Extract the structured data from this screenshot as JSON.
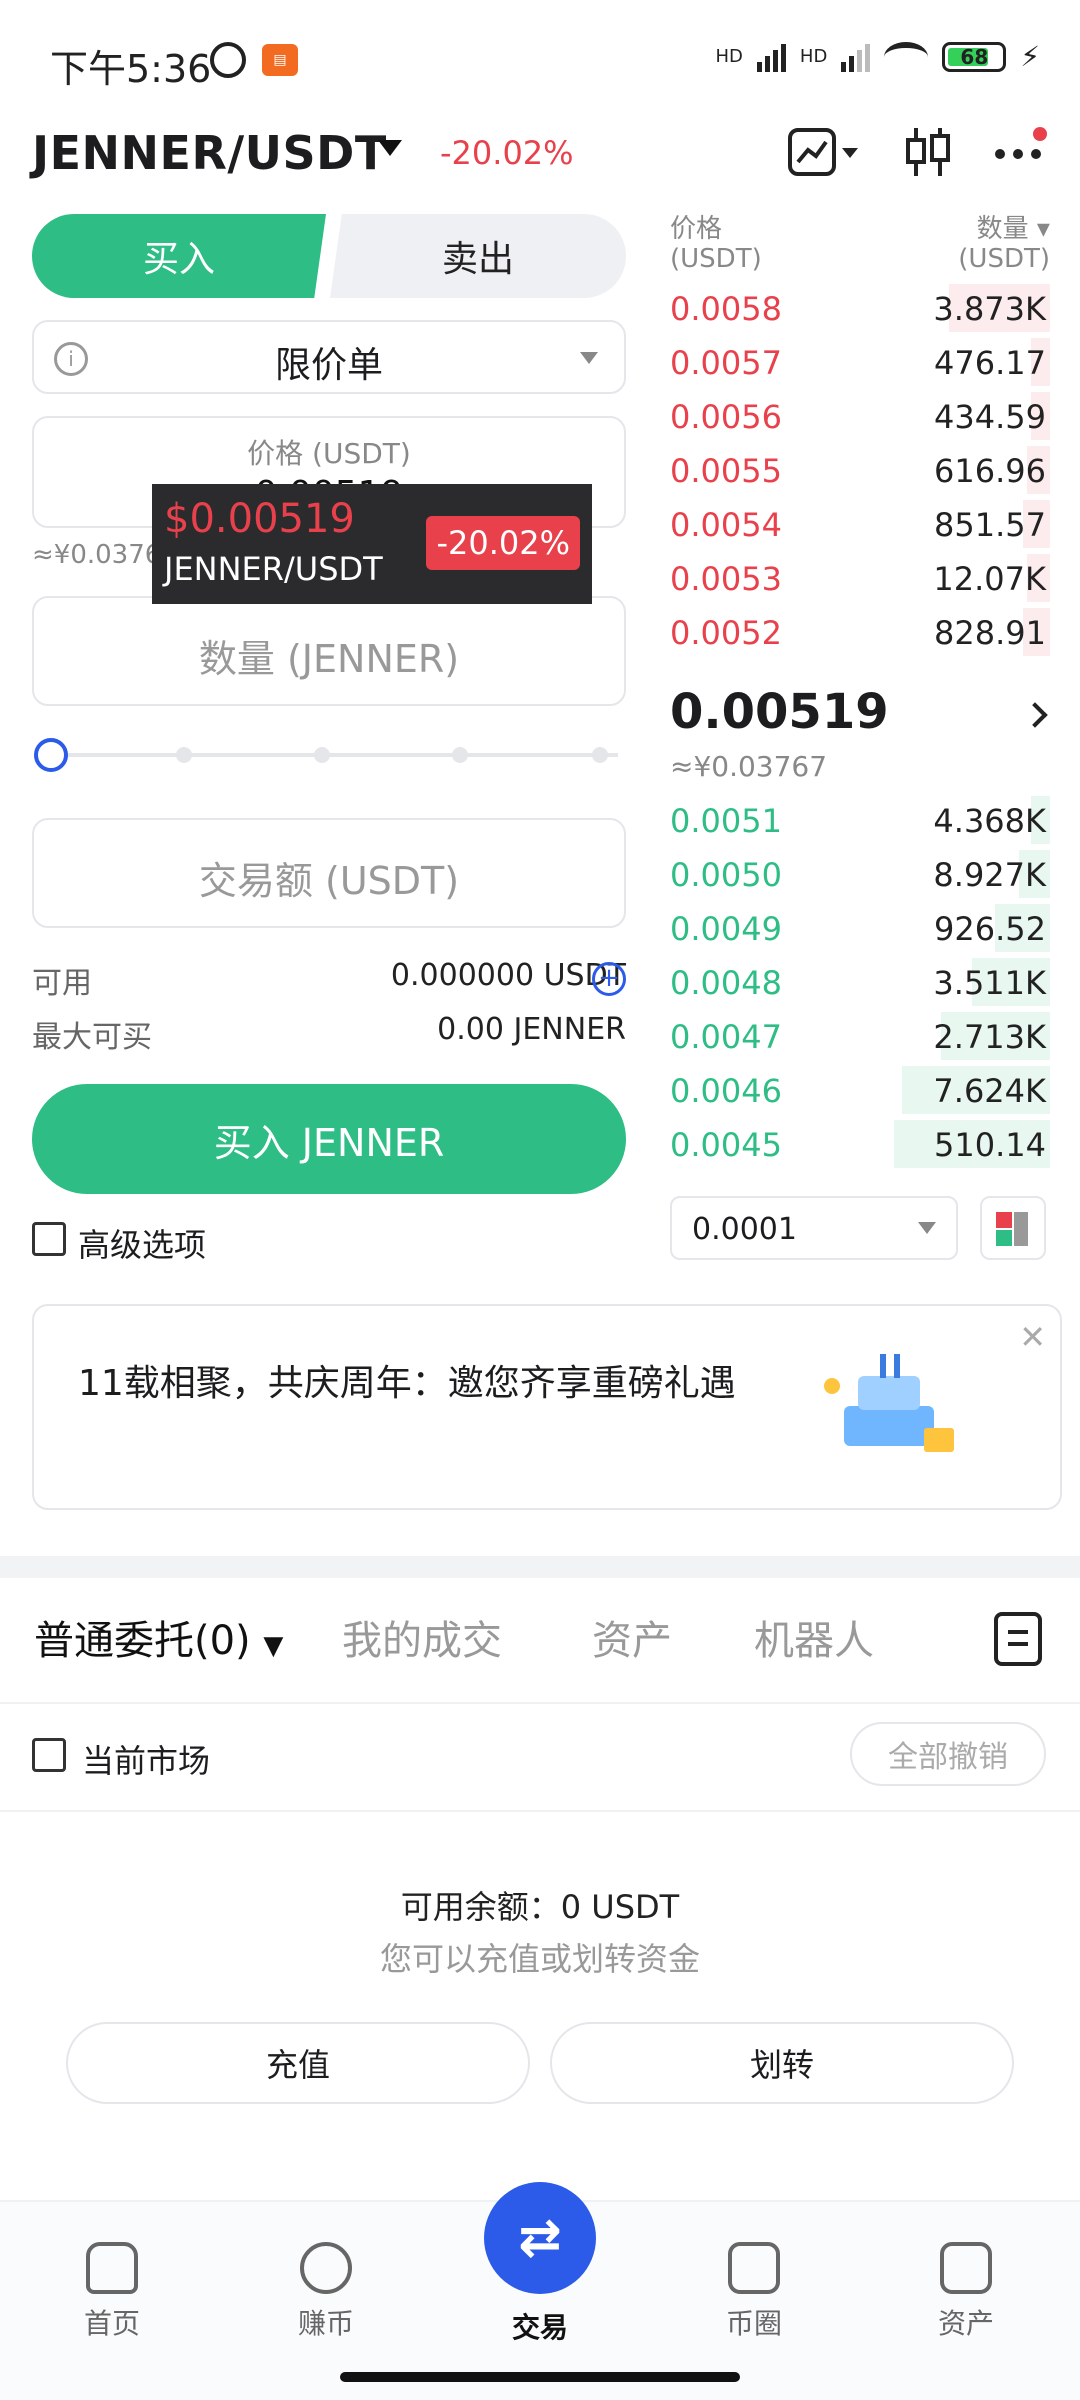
{
  "status_bar": {
    "time": "下午5:36",
    "battery": "68",
    "network_label": "HD"
  },
  "header": {
    "pair": "JENNER/USDT",
    "change": "-20.02%"
  },
  "trade_tabs": {
    "buy": "买入",
    "sell": "卖出"
  },
  "order_type": "限价单",
  "price_input": {
    "placeholder": "价格 (USDT)",
    "value": "0.00519",
    "approx": "≈¥0.03767"
  },
  "tooltip": {
    "price": "$0.00519",
    "pair": "JENNER/USDT",
    "change": "-20.02%"
  },
  "quantity_input": {
    "placeholder": "数量 (JENNER)"
  },
  "amount_input": {
    "placeholder": "交易额 (USDT)"
  },
  "available": {
    "label": "可用",
    "value": "0.000000 USDT"
  },
  "max_buy": {
    "label": "最大可买",
    "value": "0.00 JENNER"
  },
  "buy_button": "买入 JENNER",
  "advanced_option": "高级选项",
  "order_book": {
    "price_header": "价格",
    "price_unit": "(USDT)",
    "qty_header": "数量",
    "qty_unit": "(USDT)",
    "asks": [
      {
        "price": "0.0058",
        "qty": "3.873K",
        "depth": 0.26
      },
      {
        "price": "0.0057",
        "qty": "476.17",
        "depth": 0.05
      },
      {
        "price": "0.0056",
        "qty": "434.59",
        "depth": 0.05
      },
      {
        "price": "0.0055",
        "qty": "616.96",
        "depth": 0.06
      },
      {
        "price": "0.0054",
        "qty": "851.57",
        "depth": 0.07
      },
      {
        "price": "0.0053",
        "qty": "12.07K",
        "depth": 0.06
      },
      {
        "price": "0.0052",
        "qty": "828.91",
        "depth": 0.07
      }
    ],
    "last_price": "0.00519",
    "last_price_approx": "≈¥0.03767",
    "bids": [
      {
        "price": "0.0051",
        "qty": "4.368K",
        "depth": 0.05
      },
      {
        "price": "0.0050",
        "qty": "8.927K",
        "depth": 0.08
      },
      {
        "price": "0.0049",
        "qty": "926.52",
        "depth": 0.14
      },
      {
        "price": "0.0048",
        "qty": "3.511K",
        "depth": 0.2
      },
      {
        "price": "0.0047",
        "qty": "2.713K",
        "depth": 0.28
      },
      {
        "price": "0.0046",
        "qty": "7.624K",
        "depth": 0.38
      },
      {
        "price": "0.0045",
        "qty": "510.14",
        "depth": 0.4
      }
    ],
    "depth_step": "0.0001"
  },
  "banner": {
    "text": "11载相聚，共庆周年：邀您齐享重磅礼遇"
  },
  "orders_tabs": {
    "open_orders": "普通委托(0)",
    "my_trades": "我的成交",
    "assets": "资产",
    "bots": "机器人"
  },
  "current_market": "当前市场",
  "cancel_all": "全部撤销",
  "empty_state": {
    "balance": "可用余额：0 USDT",
    "hint": "您可以充值或划转资金",
    "deposit": "充值",
    "transfer": "划转"
  },
  "bottom_nav": {
    "home": "首页",
    "earn": "赚币",
    "trade": "交易",
    "community": "币圈",
    "assets": "资产"
  },
  "colors": {
    "buy_green": "#2ebd85",
    "sell_red": "#e8414c",
    "accent_blue": "#2b5be8"
  }
}
